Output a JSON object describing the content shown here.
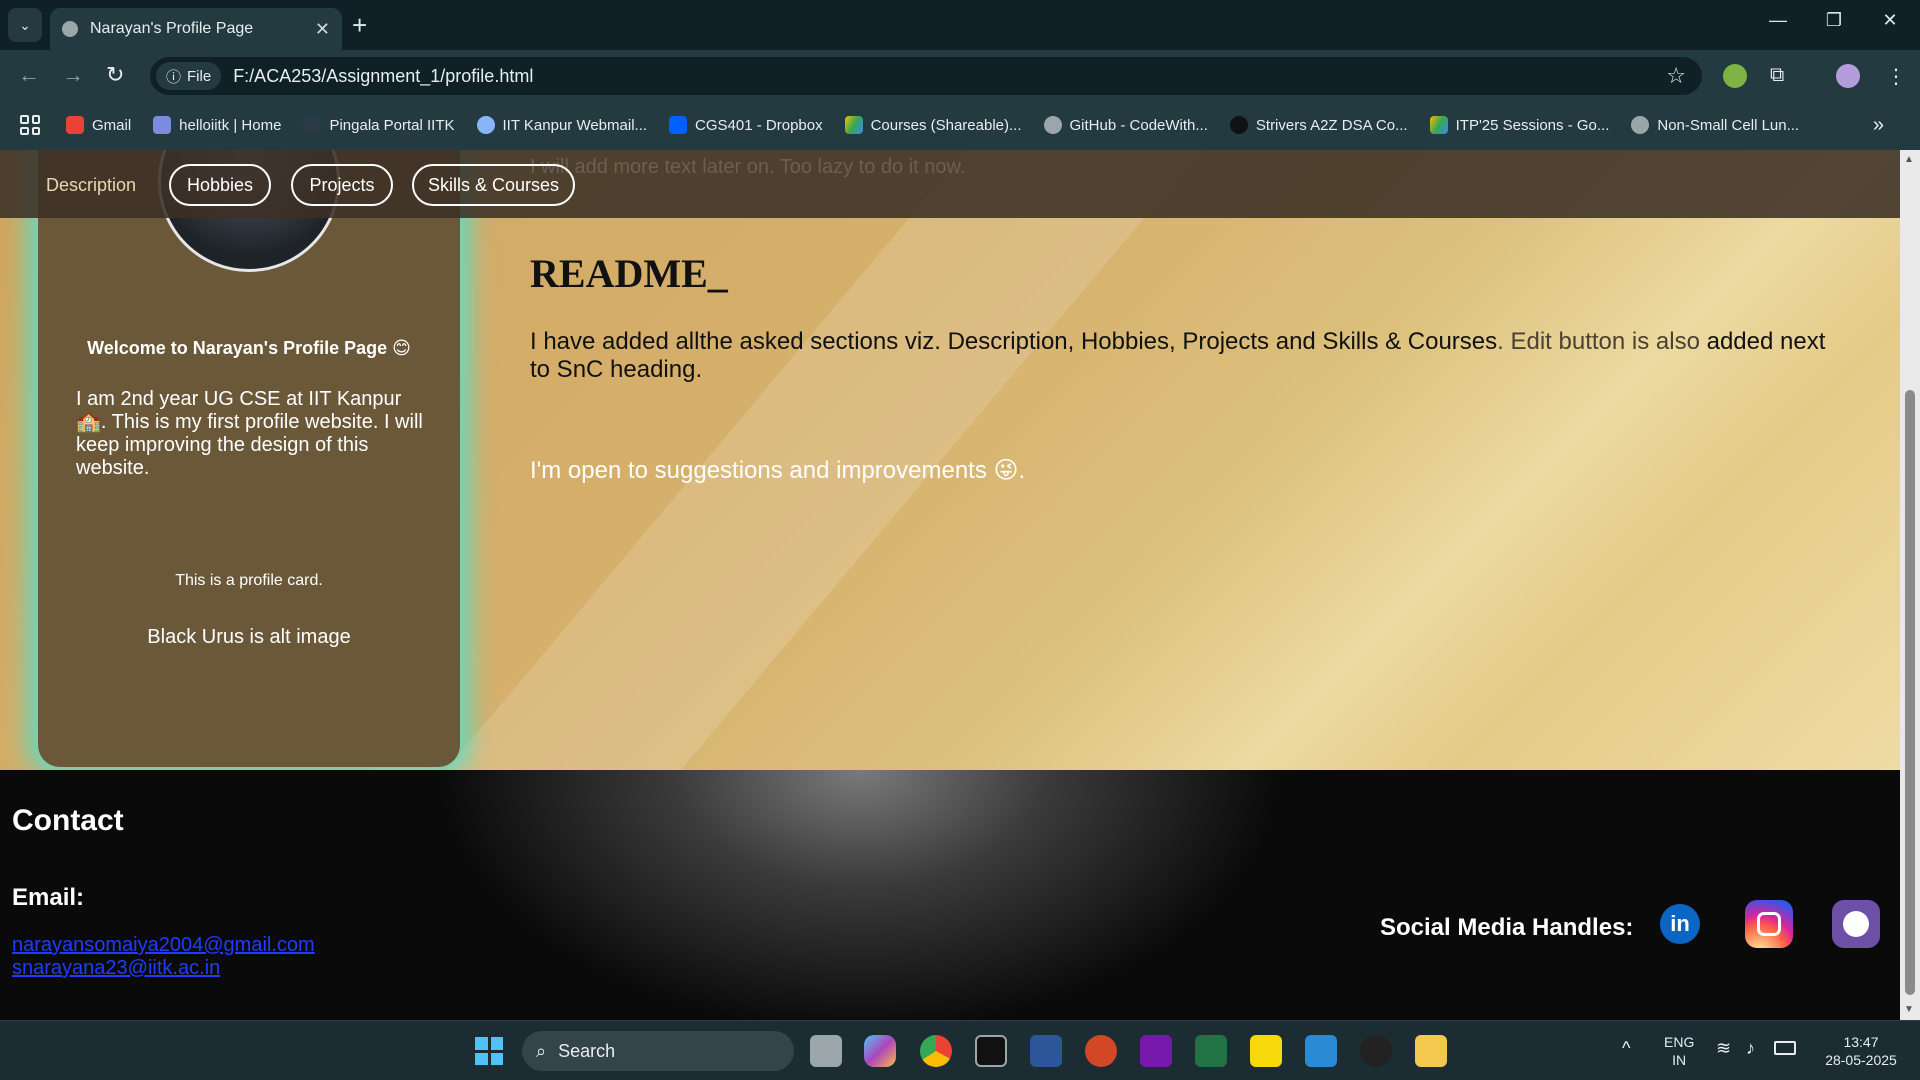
{
  "browser": {
    "tab_title": "Narayan's Profile Page",
    "new_tab": "+",
    "address_chip": "File",
    "url": "F:/ACA253/Assignment_1/profile.html",
    "bookmarks": [
      {
        "label": "Gmail",
        "color": "#ea4335"
      },
      {
        "label": "helloiitk | Home",
        "color": "#7b8cde"
      },
      {
        "label": "Pingala Portal IITK",
        "color": "#2b3b45"
      },
      {
        "label": "IIT Kanpur Webmail...",
        "color": "#8ab4f8"
      },
      {
        "label": "CGS401 - Dropbox",
        "color": "#0061ff"
      },
      {
        "label": "Courses (Shareable)...",
        "color": "#fbbc04"
      },
      {
        "label": "GitHub - CodeWith...",
        "color": "#9aa6aa"
      },
      {
        "label": "Strivers A2Z DSA Co...",
        "color": "#111111"
      },
      {
        "label": "ITP'25 Sessions - Go...",
        "color": "#34a853"
      },
      {
        "label": "Non-Small Cell Lun...",
        "color": "#9aa6aa"
      }
    ]
  },
  "page": {
    "nav": {
      "description": "Description",
      "hobbies": "Hobbies",
      "projects": "Projects",
      "skills": "Skills & Courses",
      "ghost_text": "I will add more text later on. Too lazy to do it now."
    },
    "card": {
      "welcome": "Welcome to Narayan's Profile Page 😊",
      "about": "I am 2nd year UG CSE at IIT Kanpur 🏫. This is my first profile website. I will keep improving the design of this website.",
      "note": "This is a profile card.",
      "alt": "Black Urus is alt image"
    },
    "readme": {
      "heading": "README_",
      "para_a": "I have added allthe asked sections viz. Description, Hobbies, Projects and Skills & Courses",
      "para_b": ". Edit button is also",
      "para_c": " added next to SnC heading.",
      "open": "I'm open to suggestions and improvements 😜."
    },
    "footer": {
      "contact": "Contact",
      "email_label": "Email:",
      "email_1": "narayansomaiya2004@gmail.com",
      "email_2": "snarayana23@iitk.ac.in",
      "social": "Social Media Handles:",
      "linkedin": "in"
    }
  },
  "taskbar": {
    "search": "Search",
    "lang_1": "ENG",
    "lang_2": "IN",
    "time": "13:47",
    "date": "28-05-2025"
  }
}
